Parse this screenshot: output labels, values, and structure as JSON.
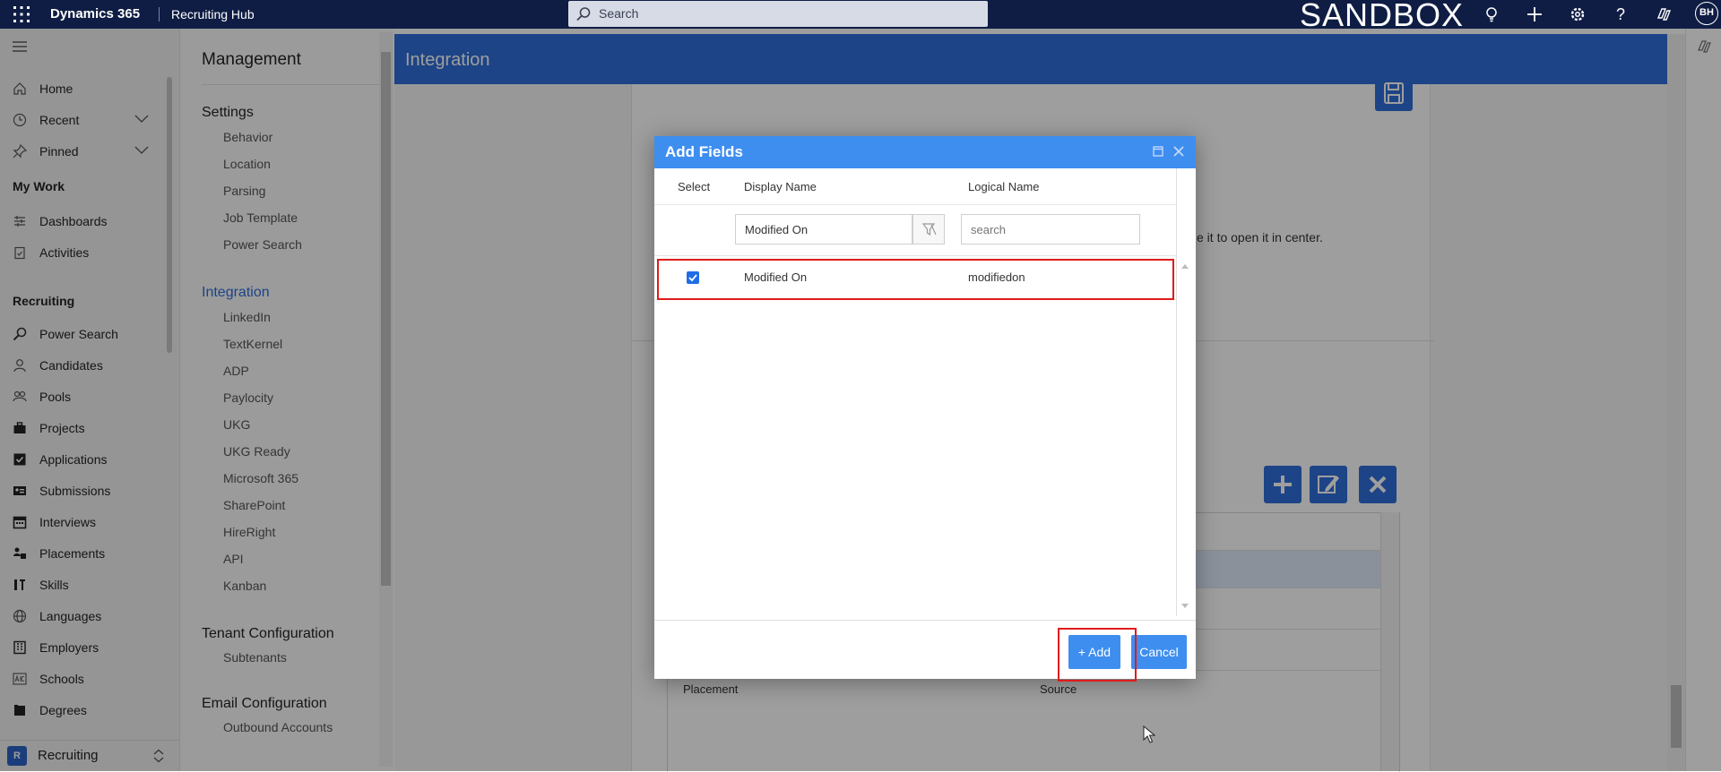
{
  "topbar": {
    "app_name": "Dynamics 365",
    "hub_name": "Recruiting Hub",
    "search_placeholder": "Search",
    "environment": "SANDBOX",
    "avatar_initials": "BH"
  },
  "leftnav": {
    "items_top": [
      {
        "label": "Home",
        "icon": "home-icon"
      },
      {
        "label": "Recent",
        "icon": "clock-icon"
      },
      {
        "label": "Pinned",
        "icon": "pin-icon"
      }
    ],
    "mywork_heading": "My Work",
    "mywork_items": [
      {
        "label": "Dashboards",
        "icon": "dashboard-icon"
      },
      {
        "label": "Activities",
        "icon": "clipboard-icon"
      }
    ],
    "recruiting_heading": "Recruiting",
    "recruiting_items": [
      {
        "label": "Power Search",
        "icon": "search-icon"
      },
      {
        "label": "Candidates",
        "icon": "person-icon"
      },
      {
        "label": "Pools",
        "icon": "group-icon"
      },
      {
        "label": "Projects",
        "icon": "briefcase-icon"
      },
      {
        "label": "Applications",
        "icon": "checkbox-icon"
      },
      {
        "label": "Submissions",
        "icon": "id-card-icon"
      },
      {
        "label": "Interviews",
        "icon": "calendar-icon"
      },
      {
        "label": "Placements",
        "icon": "placement-icon"
      },
      {
        "label": "Skills",
        "icon": "skills-icon"
      },
      {
        "label": "Languages",
        "icon": "globe-icon"
      },
      {
        "label": "Employers",
        "icon": "building-icon"
      },
      {
        "label": "Schools",
        "icon": "abc-icon"
      },
      {
        "label": "Degrees",
        "icon": "book-icon"
      }
    ],
    "area_badge": "R",
    "area_label": "Recruiting"
  },
  "settings_panel": {
    "title": "Management",
    "sections": [
      {
        "label": "Settings",
        "items": [
          "Behavior",
          "Location",
          "Parsing",
          "Job Template",
          "Power Search"
        ]
      },
      {
        "label": "Integration",
        "items": [
          "LinkedIn",
          "TextKernel",
          "ADP",
          "Paylocity",
          "UKG",
          "UKG Ready",
          "Microsoft 365",
          "SharePoint",
          "HireRight",
          "API",
          "Kanban"
        ]
      },
      {
        "label": "Tenant Configuration",
        "items": [
          "Subtenants"
        ]
      },
      {
        "label": "Email Configuration",
        "items": [
          "Outbound Accounts"
        ]
      }
    ]
  },
  "integration": {
    "title": "Integration",
    "hint": "e it to open it in center.",
    "grid_cells": {
      "placement": "Placement",
      "source": "Source"
    }
  },
  "dialog": {
    "title": "Add Fields",
    "columns": {
      "select": "Select",
      "display_name": "Display Name",
      "logical_name": "Logical Name"
    },
    "filters": {
      "display_name_value": "Modified On",
      "logical_name_placeholder": "search"
    },
    "rows": [
      {
        "checked": true,
        "display_name": "Modified On",
        "logical_name": "modifiedon"
      }
    ],
    "add_label": "+ Add",
    "cancel_label": "Cancel"
  },
  "colors": {
    "topbar": "#0f1d44",
    "accent": "#2f6fd9",
    "dialog_accent": "#3e8ef0",
    "highlight_outline": "#e01b1b"
  }
}
